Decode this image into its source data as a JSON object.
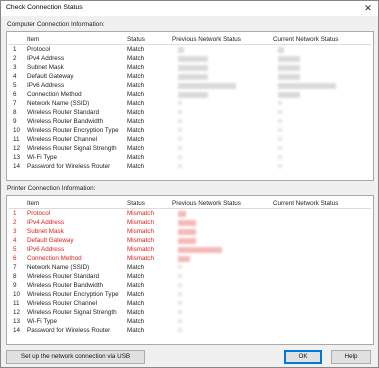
{
  "window": {
    "title": "Check Connection Status"
  },
  "computer": {
    "label": "Computer Connection Information:",
    "headers": {
      "item": "Item",
      "status": "Status",
      "prev": "Previous Network Status",
      "curr": "Current Network Status"
    },
    "rows": [
      {
        "n": "1",
        "item": "Protocol",
        "status": "Match"
      },
      {
        "n": "2",
        "item": "IPv4 Address",
        "status": "Match"
      },
      {
        "n": "3",
        "item": "Subnet Mask",
        "status": "Match"
      },
      {
        "n": "4",
        "item": "Default Gateway",
        "status": "Match"
      },
      {
        "n": "5",
        "item": "IPv6 Address",
        "status": "Match"
      },
      {
        "n": "6",
        "item": "Connection Method",
        "status": "Match"
      },
      {
        "n": "7",
        "item": "Network Name (SSID)",
        "status": "Match"
      },
      {
        "n": "8",
        "item": "Wireless Router Standard",
        "status": "Match"
      },
      {
        "n": "9",
        "item": "Wireless Router Bandwidth",
        "status": "Match"
      },
      {
        "n": "10",
        "item": "Wireless Router Encryption Type",
        "status": "Match"
      },
      {
        "n": "11",
        "item": "Wireless Router Channel",
        "status": "Match"
      },
      {
        "n": "12",
        "item": "Wireless Router Signal Strength",
        "status": "Match"
      },
      {
        "n": "13",
        "item": "Wi-Fi Type",
        "status": "Match"
      },
      {
        "n": "14",
        "item": "Password for Wireless Router",
        "status": "Match"
      }
    ]
  },
  "printer": {
    "label": "Printer Connection Information:",
    "headers": {
      "item": "Item",
      "status": "Status",
      "prev": "Previous Network Status",
      "curr": "Current Network Status"
    },
    "rows": [
      {
        "n": "1",
        "item": "Protocol",
        "status": "Mismatch"
      },
      {
        "n": "2",
        "item": "IPv4 Address",
        "status": "Mismatch"
      },
      {
        "n": "3",
        "item": "Subnet Mask",
        "status": "Mismatch"
      },
      {
        "n": "4",
        "item": "Default Gateway",
        "status": "Mismatch"
      },
      {
        "n": "5",
        "item": "IPv6 Address",
        "status": "Mismatch"
      },
      {
        "n": "6",
        "item": "Connection Method",
        "status": "Mismatch"
      },
      {
        "n": "7",
        "item": "Network Name (SSID)",
        "status": "Match"
      },
      {
        "n": "8",
        "item": "Wireless Router Standard",
        "status": "Match"
      },
      {
        "n": "9",
        "item": "Wireless Router Bandwidth",
        "status": "Match"
      },
      {
        "n": "10",
        "item": "Wireless Router Encryption Type",
        "status": "Match"
      },
      {
        "n": "11",
        "item": "Wireless Router Channel",
        "status": "Match"
      },
      {
        "n": "12",
        "item": "Wireless Router Signal Strength",
        "status": "Match"
      },
      {
        "n": "13",
        "item": "Wi-Fi Type",
        "status": "Match"
      },
      {
        "n": "14",
        "item": "Password for Wireless Router",
        "status": "Match"
      }
    ]
  },
  "colors": {
    "mismatch": "#e0201c",
    "default_button_border": "#0078d7"
  },
  "buttons": {
    "usb": "Set up the network connection via USB",
    "ok": "OK",
    "help": "Help"
  }
}
